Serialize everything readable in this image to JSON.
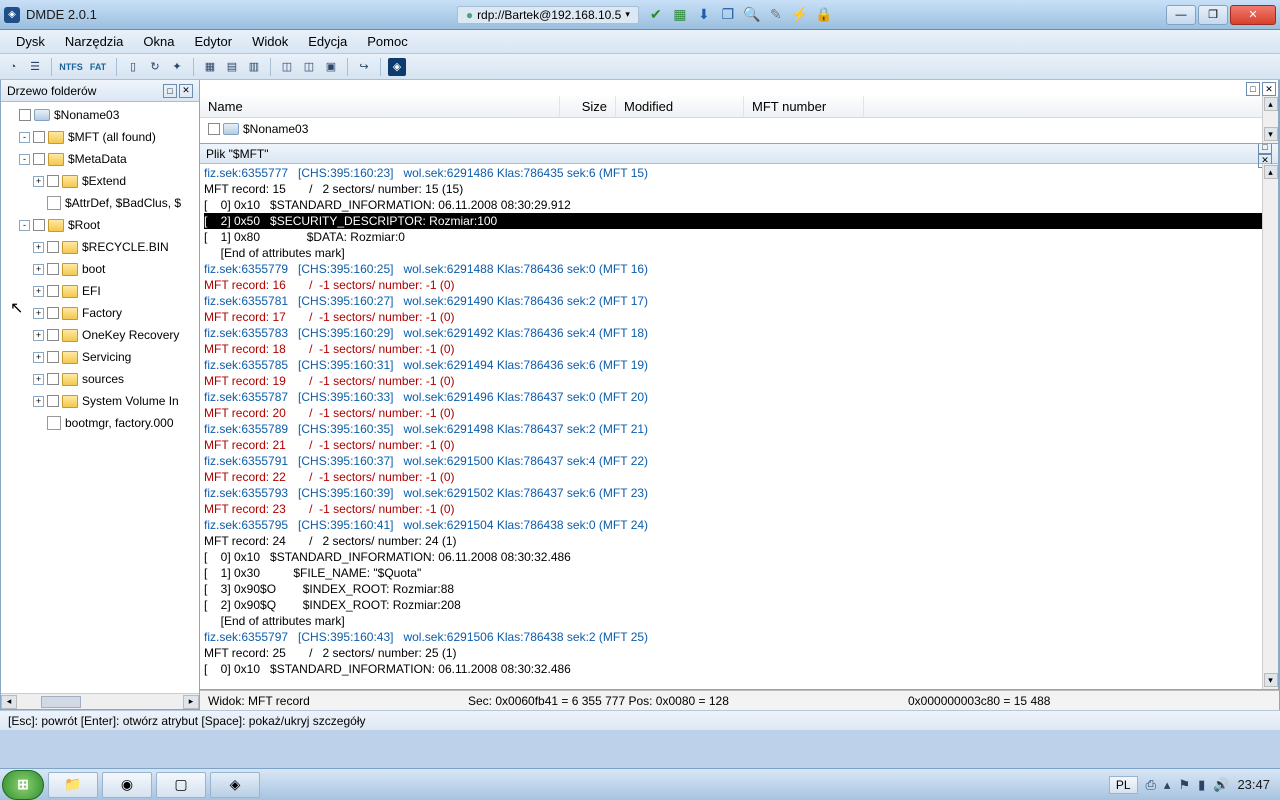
{
  "title": "DMDE 2.0.1",
  "rdp": "rdp://Bartek@192.168.10.5",
  "menu": [
    "Dysk",
    "Narzędzia",
    "Okna",
    "Edytor",
    "Widok",
    "Edycja",
    "Pomoc"
  ],
  "tree_title": "Drzewo folderów",
  "tree": [
    {
      "d": 1,
      "exp": "",
      "chk": true,
      "icon": "disk",
      "label": "$Noname03"
    },
    {
      "d": 2,
      "exp": "-",
      "chk": true,
      "icon": "fld",
      "label": "$MFT (all found)"
    },
    {
      "d": 2,
      "exp": "-",
      "chk": true,
      "icon": "fld",
      "label": "$MetaData"
    },
    {
      "d": 3,
      "exp": "+",
      "chk": true,
      "icon": "fld",
      "label": "$Extend"
    },
    {
      "d": 3,
      "exp": "",
      "chk": false,
      "icon": "file",
      "label": "$AttrDef, $BadClus, $"
    },
    {
      "d": 2,
      "exp": "-",
      "chk": true,
      "icon": "fld",
      "label": "$Root"
    },
    {
      "d": 3,
      "exp": "+",
      "chk": true,
      "icon": "fld",
      "label": "$RECYCLE.BIN"
    },
    {
      "d": 3,
      "exp": "+",
      "chk": true,
      "icon": "fld",
      "label": "boot"
    },
    {
      "d": 3,
      "exp": "+",
      "chk": true,
      "icon": "fld",
      "label": "EFI"
    },
    {
      "d": 3,
      "exp": "+",
      "chk": true,
      "icon": "fld",
      "label": "Factory"
    },
    {
      "d": 3,
      "exp": "+",
      "chk": true,
      "icon": "fld",
      "label": "OneKey Recovery"
    },
    {
      "d": 3,
      "exp": "+",
      "chk": true,
      "icon": "fld",
      "label": "Servicing"
    },
    {
      "d": 3,
      "exp": "+",
      "chk": true,
      "icon": "fld",
      "label": "sources"
    },
    {
      "d": 3,
      "exp": "+",
      "chk": true,
      "icon": "fld",
      "label": "System Volume In"
    },
    {
      "d": 3,
      "exp": "",
      "chk": false,
      "icon": "file",
      "label": "bootmgr, factory.000"
    }
  ],
  "cols": {
    "name": "Name",
    "size": "Size",
    "modified": "Modified",
    "mft": "MFT number"
  },
  "file_row": "$Noname03",
  "mft_title": "Plik \"$MFT\"",
  "mft_lines": [
    {
      "cls": "c-blue",
      "t": "fiz.sek:6355777   [CHS:395:160:23]   wol.sek:6291486 Klas:786435 sek:6 (MFT 15)"
    },
    {
      "cls": "c-black",
      "t": "MFT record: 15       /   2 sectors/ number: 15 (15)"
    },
    {
      "cls": "c-black",
      "t": "[    0] 0x10   $STANDARD_INFORMATION: 06.11.2008 08:30:29.912"
    },
    {
      "cls": "selected",
      "t": "[    2] 0x50   $SECURITY_DESCRIPTOR: Rozmiar:100"
    },
    {
      "cls": "c-black",
      "t": "[    1] 0x80              $DATA: Rozmiar:0"
    },
    {
      "cls": "c-black",
      "t": "     [End of attributes mark]"
    },
    {
      "cls": "c-blue",
      "t": "fiz.sek:6355779   [CHS:395:160:25]   wol.sek:6291488 Klas:786436 sek:0 (MFT 16)"
    },
    {
      "cls": "c-red",
      "t": "MFT record: 16       /  -1 sectors/ number: -1 (0)"
    },
    {
      "cls": "c-blue",
      "t": "fiz.sek:6355781   [CHS:395:160:27]   wol.sek:6291490 Klas:786436 sek:2 (MFT 17)"
    },
    {
      "cls": "c-red",
      "t": "MFT record: 17       /  -1 sectors/ number: -1 (0)"
    },
    {
      "cls": "c-blue",
      "t": "fiz.sek:6355783   [CHS:395:160:29]   wol.sek:6291492 Klas:786436 sek:4 (MFT 18)"
    },
    {
      "cls": "c-red",
      "t": "MFT record: 18       /  -1 sectors/ number: -1 (0)"
    },
    {
      "cls": "c-blue",
      "t": "fiz.sek:6355785   [CHS:395:160:31]   wol.sek:6291494 Klas:786436 sek:6 (MFT 19)"
    },
    {
      "cls": "c-red",
      "t": "MFT record: 19       /  -1 sectors/ number: -1 (0)"
    },
    {
      "cls": "c-blue",
      "t": "fiz.sek:6355787   [CHS:395:160:33]   wol.sek:6291496 Klas:786437 sek:0 (MFT 20)"
    },
    {
      "cls": "c-red",
      "t": "MFT record: 20       /  -1 sectors/ number: -1 (0)"
    },
    {
      "cls": "c-blue",
      "t": "fiz.sek:6355789   [CHS:395:160:35]   wol.sek:6291498 Klas:786437 sek:2 (MFT 21)"
    },
    {
      "cls": "c-red",
      "t": "MFT record: 21       /  -1 sectors/ number: -1 (0)"
    },
    {
      "cls": "c-blue",
      "t": "fiz.sek:6355791   [CHS:395:160:37]   wol.sek:6291500 Klas:786437 sek:4 (MFT 22)"
    },
    {
      "cls": "c-red",
      "t": "MFT record: 22       /  -1 sectors/ number: -1 (0)"
    },
    {
      "cls": "c-blue",
      "t": "fiz.sek:6355793   [CHS:395:160:39]   wol.sek:6291502 Klas:786437 sek:6 (MFT 23)"
    },
    {
      "cls": "c-red",
      "t": "MFT record: 23       /  -1 sectors/ number: -1 (0)"
    },
    {
      "cls": "c-blue",
      "t": "fiz.sek:6355795   [CHS:395:160:41]   wol.sek:6291504 Klas:786438 sek:0 (MFT 24)"
    },
    {
      "cls": "c-black",
      "t": "MFT record: 24       /   2 sectors/ number: 24 (1)"
    },
    {
      "cls": "c-black",
      "t": "[    0] 0x10   $STANDARD_INFORMATION: 06.11.2008 08:30:32.486"
    },
    {
      "cls": "c-black",
      "t": "[    1] 0x30          $FILE_NAME: \"$Quota\""
    },
    {
      "cls": "c-black",
      "t": "[    3] 0x90$O        $INDEX_ROOT: Rozmiar:88"
    },
    {
      "cls": "c-black",
      "t": "[    2] 0x90$Q        $INDEX_ROOT: Rozmiar:208"
    },
    {
      "cls": "c-black",
      "t": "     [End of attributes mark]"
    },
    {
      "cls": "c-blue",
      "t": "fiz.sek:6355797   [CHS:395:160:43]   wol.sek:6291506 Klas:786438 sek:2 (MFT 25)"
    },
    {
      "cls": "c-black",
      "t": "MFT record: 25       /   2 sectors/ number: 25 (1)"
    },
    {
      "cls": "c-black",
      "t": "[    0] 0x10   $STANDARD_INFORMATION: 06.11.2008 08:30:32.486"
    }
  ],
  "status": {
    "view": "Widok: MFT record",
    "sec": "Sec: 0x0060fb41 = 6 355 777  Pos: 0x0080 = 128",
    "addr": "0x000000003c80 = 15 488"
  },
  "hint": "[Esc]: powrót  [Enter]: otwórz atrybut  [Space]: pokaż/ukryj szczegóły",
  "lang": "PL",
  "clock": "23:47"
}
